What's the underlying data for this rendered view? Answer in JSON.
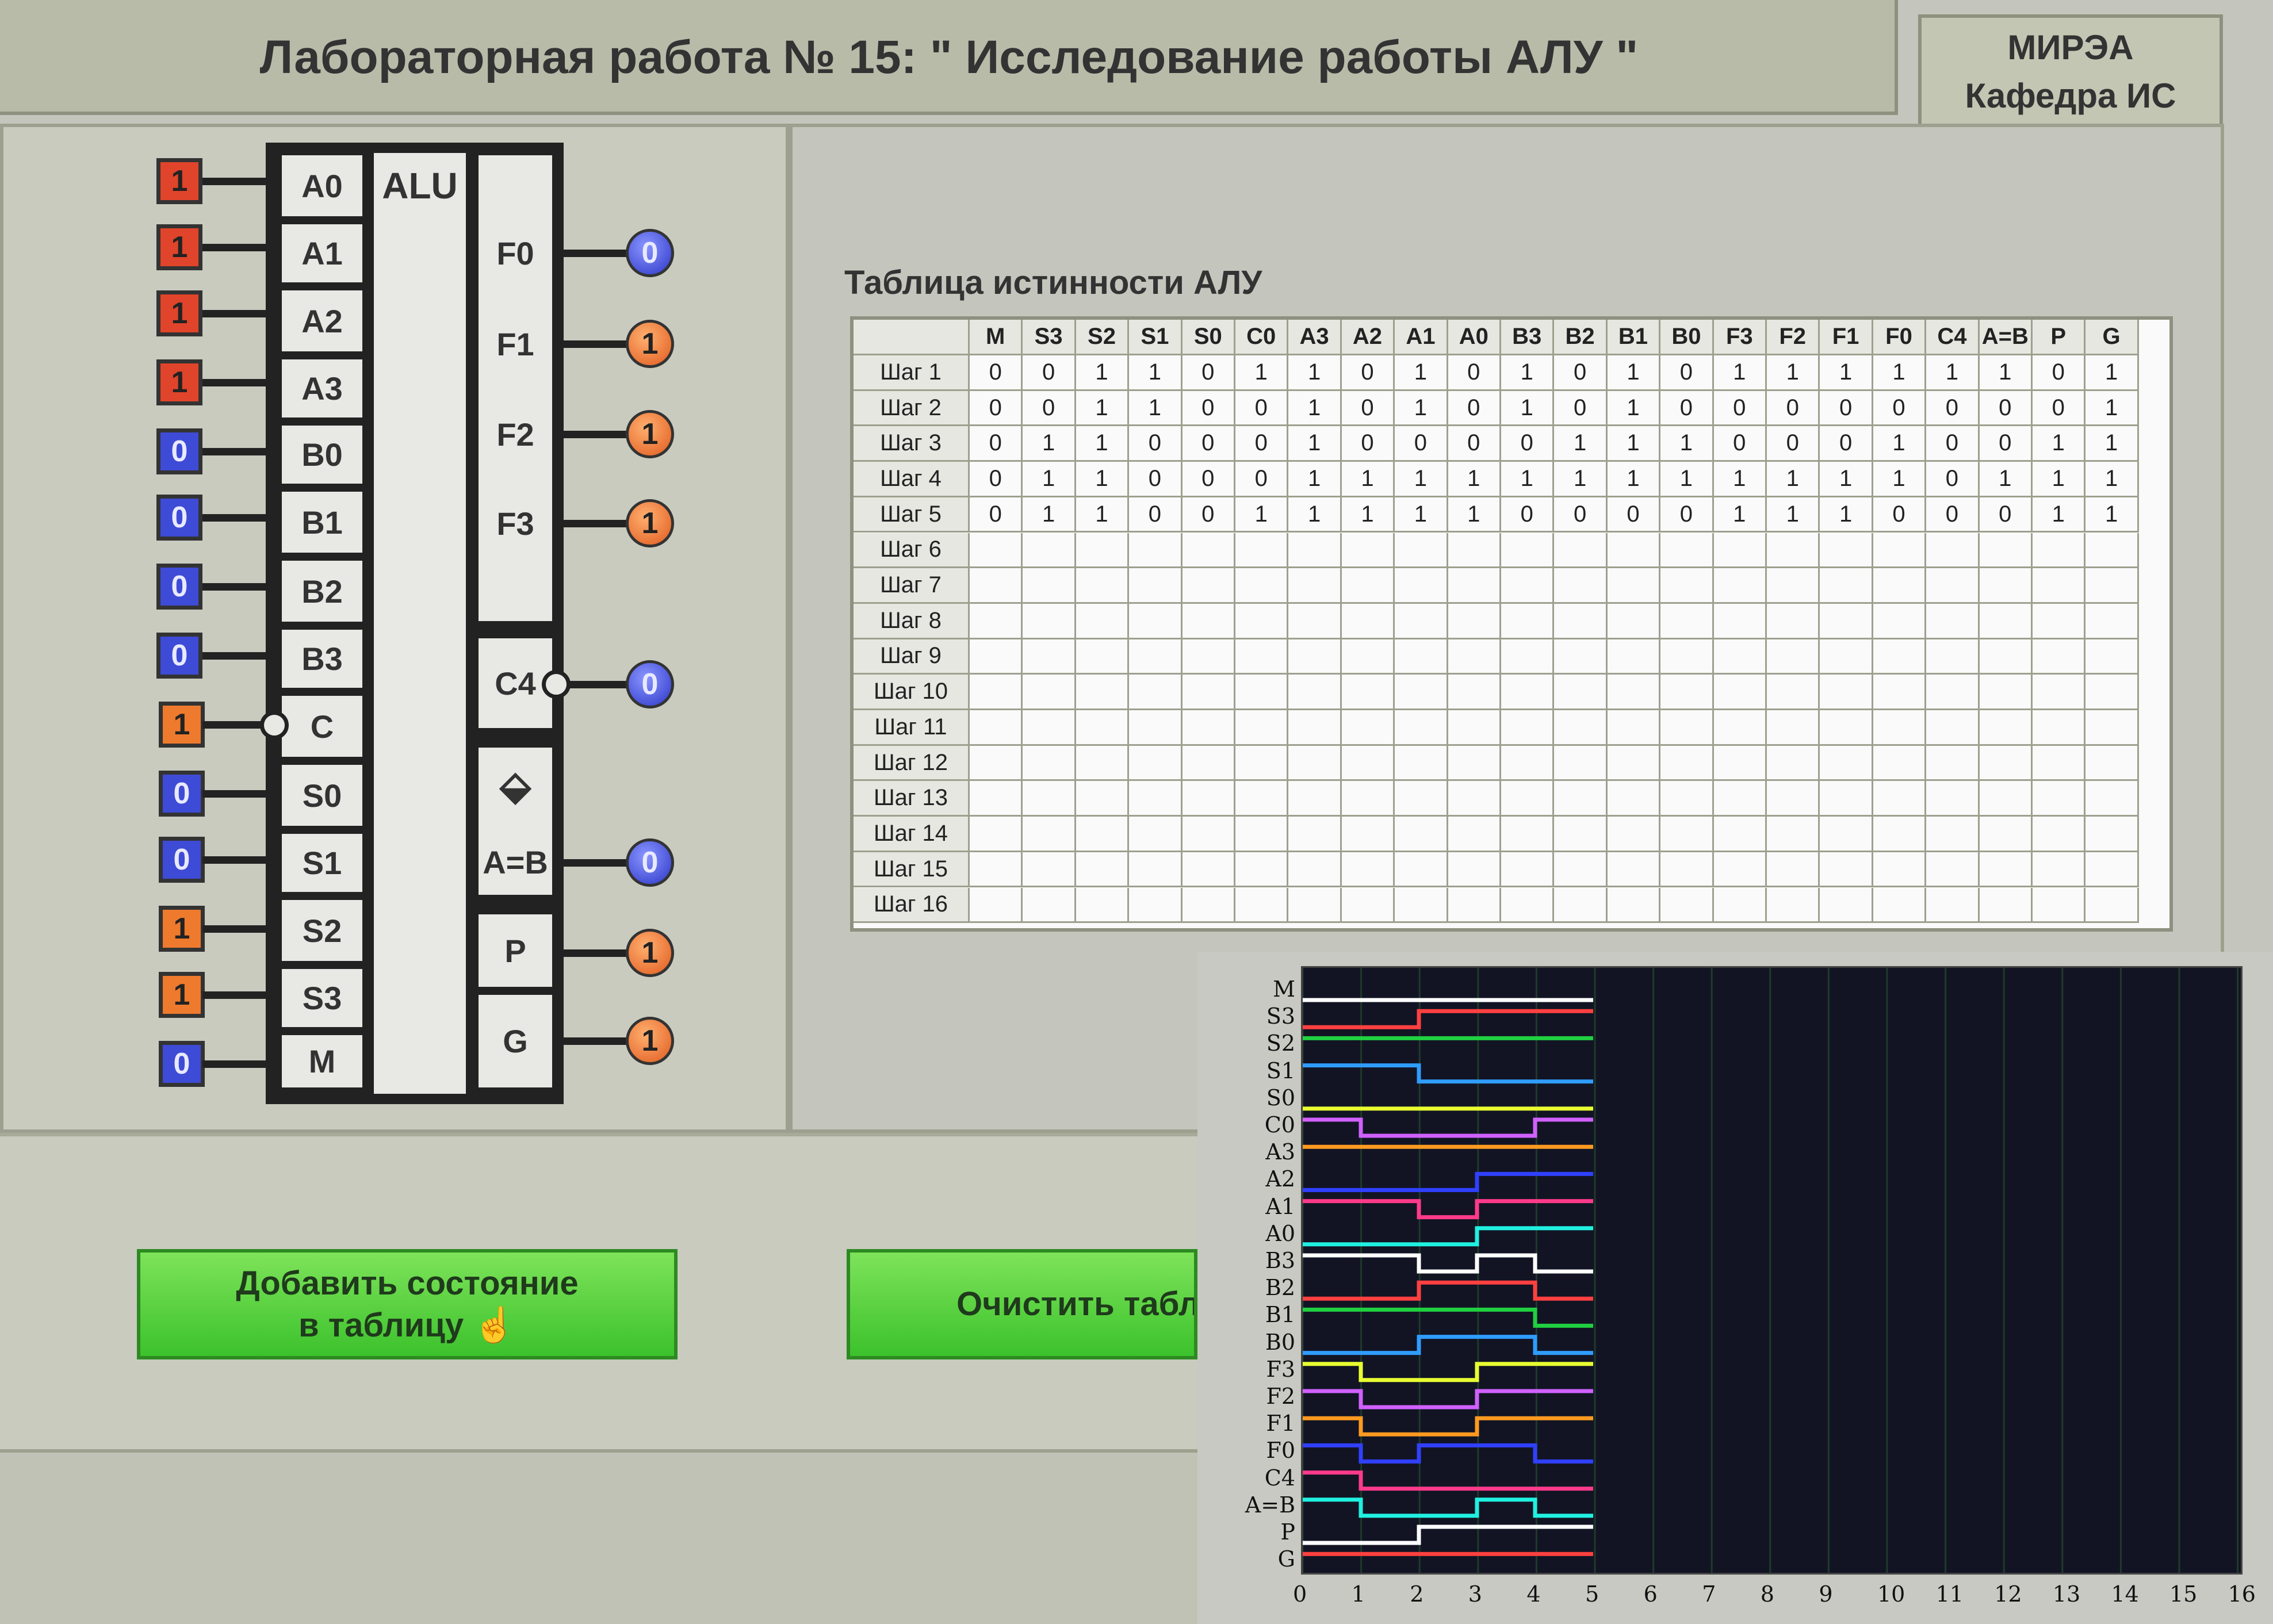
{
  "header": {
    "title": "Лабораторная работа № 15: \" Исследование работы АЛУ \"",
    "org_line1": "МИРЭА",
    "org_line2": "Кафедра ИС"
  },
  "alu": {
    "label": "ALU",
    "inputs": [
      {
        "name": "A0",
        "value": "1",
        "color": "red"
      },
      {
        "name": "A1",
        "value": "1",
        "color": "red"
      },
      {
        "name": "A2",
        "value": "1",
        "color": "red"
      },
      {
        "name": "A3",
        "value": "1",
        "color": "red"
      },
      {
        "name": "B0",
        "value": "0",
        "color": "blue"
      },
      {
        "name": "B1",
        "value": "0",
        "color": "blue"
      },
      {
        "name": "B2",
        "value": "0",
        "color": "blue"
      },
      {
        "name": "B3",
        "value": "0",
        "color": "blue"
      },
      {
        "name": "C",
        "value": "1",
        "color": "orange"
      },
      {
        "name": "S0",
        "value": "0",
        "color": "blue"
      },
      {
        "name": "S1",
        "value": "0",
        "color": "blue"
      },
      {
        "name": "S2",
        "value": "1",
        "color": "orange"
      },
      {
        "name": "S3",
        "value": "1",
        "color": "orange"
      },
      {
        "name": "M",
        "value": "0",
        "color": "blue"
      }
    ],
    "outputs": [
      {
        "name": "F0",
        "value": "0",
        "color": "blue"
      },
      {
        "name": "F1",
        "value": "1",
        "color": "orange"
      },
      {
        "name": "F2",
        "value": "1",
        "color": "orange"
      },
      {
        "name": "F3",
        "value": "1",
        "color": "orange"
      },
      {
        "name": "C4",
        "value": "0",
        "color": "blue"
      },
      {
        "name": "A=B",
        "value": "0",
        "color": "blue"
      },
      {
        "name": "P",
        "value": "1",
        "color": "orange"
      },
      {
        "name": "G",
        "value": "1",
        "color": "orange"
      }
    ],
    "compare_symbol": "⬙"
  },
  "table": {
    "title": "Таблица истинности АЛУ",
    "columns": [
      "M",
      "S3",
      "S2",
      "S1",
      "S0",
      "C0",
      "A3",
      "A2",
      "A1",
      "A0",
      "B3",
      "B2",
      "B1",
      "B0",
      "F3",
      "F2",
      "F1",
      "F0",
      "C4",
      "A=B",
      "P",
      "G"
    ],
    "rows": [
      {
        "label": "Шаг 1",
        "values": [
          "0",
          "0",
          "1",
          "1",
          "0",
          "1",
          "1",
          "0",
          "1",
          "0",
          "1",
          "0",
          "1",
          "0",
          "1",
          "1",
          "1",
          "1",
          "1",
          "1",
          "0",
          "1"
        ]
      },
      {
        "label": "Шаг 2",
        "values": [
          "0",
          "0",
          "1",
          "1",
          "0",
          "0",
          "1",
          "0",
          "1",
          "0",
          "1",
          "0",
          "1",
          "0",
          "0",
          "0",
          "0",
          "0",
          "0",
          "0",
          "0",
          "1"
        ]
      },
      {
        "label": "Шаг 3",
        "values": [
          "0",
          "1",
          "1",
          "0",
          "0",
          "0",
          "1",
          "0",
          "0",
          "0",
          "0",
          "1",
          "1",
          "1",
          "0",
          "0",
          "0",
          "1",
          "0",
          "0",
          "1",
          "1"
        ]
      },
      {
        "label": "Шаг 4",
        "values": [
          "0",
          "1",
          "1",
          "0",
          "0",
          "0",
          "1",
          "1",
          "1",
          "1",
          "1",
          "1",
          "1",
          "1",
          "1",
          "1",
          "1",
          "1",
          "0",
          "1",
          "1",
          "1"
        ]
      },
      {
        "label": "Шаг 5",
        "values": [
          "0",
          "1",
          "1",
          "0",
          "0",
          "1",
          "1",
          "1",
          "1",
          "1",
          "0",
          "0",
          "0",
          "0",
          "1",
          "1",
          "1",
          "0",
          "0",
          "0",
          "1",
          "1"
        ]
      },
      {
        "label": "Шаг 6",
        "values": []
      },
      {
        "label": "Шаг 7",
        "values": []
      },
      {
        "label": "Шаг 8",
        "values": []
      },
      {
        "label": "Шаг 9",
        "values": []
      },
      {
        "label": "Шаг 10",
        "values": []
      },
      {
        "label": "Шаг 11",
        "values": []
      },
      {
        "label": "Шаг 12",
        "values": []
      },
      {
        "label": "Шаг 13",
        "values": []
      },
      {
        "label": "Шаг 14",
        "values": []
      },
      {
        "label": "Шаг 15",
        "values": []
      },
      {
        "label": "Шаг 16",
        "values": []
      }
    ]
  },
  "buttons": {
    "add_state_line1": "Добавить состояние",
    "add_state_line2": "в таблицу",
    "clear_table": "Очистить табл"
  },
  "timing": {
    "signals": [
      "M",
      "S3",
      "S2",
      "S1",
      "S0",
      "C0",
      "A3",
      "A2",
      "A1",
      "A0",
      "B3",
      "B2",
      "B1",
      "B0",
      "F3",
      "F2",
      "F1",
      "F0",
      "C4",
      "A=B",
      "P",
      "G"
    ],
    "x_ticks": [
      "0",
      "1",
      "2",
      "3",
      "4",
      "5",
      "6",
      "7",
      "8",
      "9",
      "10",
      "11",
      "12",
      "13",
      "14",
      "15",
      "16"
    ],
    "colors": [
      "#ffffff",
      "#ff4040",
      "#20d040",
      "#2f9cff",
      "#e8ff30",
      "#d060ff",
      "#ff9a20",
      "#3040ff",
      "#ff3a8a",
      "#20f0e0",
      "#ffffff",
      "#ff4040",
      "#20d040",
      "#2f9cff",
      "#e8ff30",
      "#d060ff",
      "#ff9a20",
      "#3040ff",
      "#ff3a8a",
      "#20f0e0",
      "#ffffff",
      "#ff4040"
    ]
  }
}
